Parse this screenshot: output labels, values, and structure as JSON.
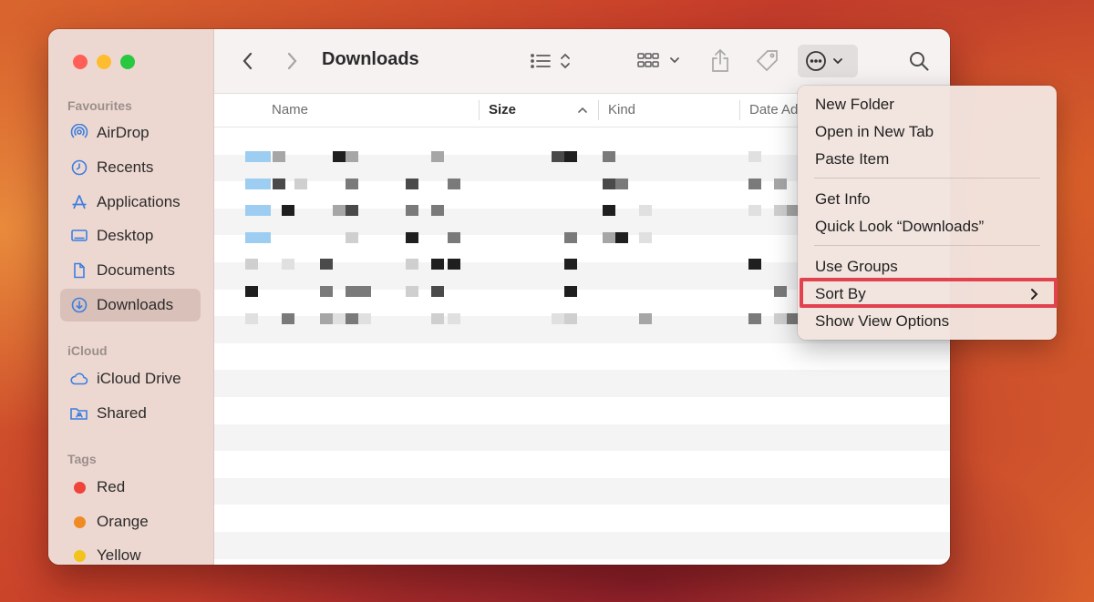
{
  "window": {
    "title": "Downloads"
  },
  "sidebar": {
    "favourites_label": "Favourites",
    "favourites": [
      {
        "label": "AirDrop",
        "icon": "airdrop-icon"
      },
      {
        "label": "Recents",
        "icon": "clock-icon"
      },
      {
        "label": "Applications",
        "icon": "applications-icon"
      },
      {
        "label": "Desktop",
        "icon": "desktop-icon"
      },
      {
        "label": "Documents",
        "icon": "document-icon"
      },
      {
        "label": "Downloads",
        "icon": "download-icon"
      }
    ],
    "icloud_label": "iCloud",
    "icloud": [
      {
        "label": "iCloud Drive",
        "icon": "cloud-icon"
      },
      {
        "label": "Shared",
        "icon": "shared-folder-icon"
      }
    ],
    "tags_label": "Tags",
    "tags": [
      {
        "label": "Red",
        "color": "#f0433a"
      },
      {
        "label": "Orange",
        "color": "#f08a24"
      },
      {
        "label": "Yellow",
        "color": "#f2c31b"
      }
    ]
  },
  "columns": {
    "name": "Name",
    "size": "Size",
    "kind": "Kind",
    "date": "Date Ad"
  },
  "menu": {
    "items": [
      "New Folder",
      "Open in New Tab",
      "Paste Item",
      "Get Info",
      "Quick Look “Downloads”",
      "Use Groups",
      "Sort By",
      "Show View Options"
    ]
  },
  "colors": {
    "accent": "#3c7ee0",
    "highlight": "#e2414e"
  }
}
